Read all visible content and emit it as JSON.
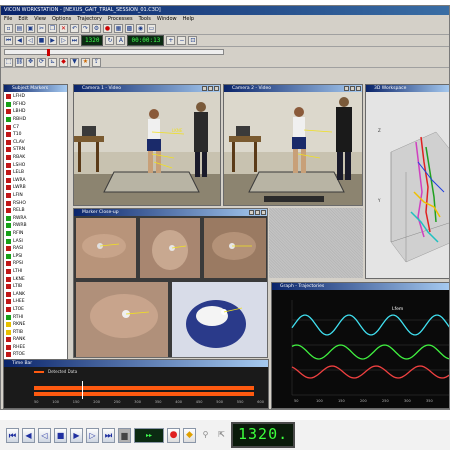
{
  "window": {
    "title": "VICON WORKSTATION - [NEXUS_GAIT_TRIAL_SESSION_01.C3D]",
    "menu": [
      "File",
      "Edit",
      "View",
      "Options",
      "Trajectory",
      "Processes",
      "Tools",
      "Window",
      "Help"
    ]
  },
  "toolbar": {
    "frame_readout": "1320",
    "time_readout": "00:00:13"
  },
  "tree": {
    "items": [
      {
        "label": "LFHD",
        "color": "#c01818"
      },
      {
        "label": "RFHD",
        "color": "#18a018"
      },
      {
        "label": "LBHD",
        "color": "#c01818"
      },
      {
        "label": "RBHD",
        "color": "#18a018"
      },
      {
        "label": "C7",
        "color": "#c01818"
      },
      {
        "label": "T10",
        "color": "#c01818"
      },
      {
        "label": "CLAV",
        "color": "#c01818"
      },
      {
        "label": "STRN",
        "color": "#c01818"
      },
      {
        "label": "RBAK",
        "color": "#c01818"
      },
      {
        "label": "LSHO",
        "color": "#c01818"
      },
      {
        "label": "LELB",
        "color": "#c01818"
      },
      {
        "label": "LWRA",
        "color": "#c01818"
      },
      {
        "label": "LWRB",
        "color": "#c01818"
      },
      {
        "label": "LFIN",
        "color": "#c01818"
      },
      {
        "label": "RSHO",
        "color": "#c01818"
      },
      {
        "label": "RELB",
        "color": "#c01818"
      },
      {
        "label": "RWRA",
        "color": "#18a018"
      },
      {
        "label": "RWRB",
        "color": "#18a018"
      },
      {
        "label": "RFIN",
        "color": "#18a018"
      },
      {
        "label": "LASI",
        "color": "#18a018"
      },
      {
        "label": "RASI",
        "color": "#c01818"
      },
      {
        "label": "LPSI",
        "color": "#18a018"
      },
      {
        "label": "RPSI",
        "color": "#c01818"
      },
      {
        "label": "LTHI",
        "color": "#c01818"
      },
      {
        "label": "LKNE",
        "color": "#c01818"
      },
      {
        "label": "LTIB",
        "color": "#c01818"
      },
      {
        "label": "LANK",
        "color": "#c01818"
      },
      {
        "label": "LHEE",
        "color": "#c01818"
      },
      {
        "label": "LTOE",
        "color": "#c01818"
      },
      {
        "label": "RTHI",
        "color": "#18a018"
      },
      {
        "label": "RKNE",
        "color": "#e8c000"
      },
      {
        "label": "RTIB",
        "color": "#e8c000"
      },
      {
        "label": "RANK",
        "color": "#c01818"
      },
      {
        "label": "RHEE",
        "color": "#c01818"
      },
      {
        "label": "RTOE",
        "color": "#c01818"
      },
      {
        "label": "PELV",
        "color": "#e8c000"
      },
      {
        "label": "Kinetic",
        "color": "#2040c0"
      }
    ]
  },
  "panels": {
    "tree_title": "Subject Markers",
    "cam1_title": "Camera 1 - Video",
    "cam2_title": "Camera 2 - Video",
    "view3d_title": "3D Workspace",
    "zoom_title": "Marker Close-up",
    "graph_title": "Graph - Trajectories",
    "timeline_title": "Time Bar"
  },
  "graph": {
    "legend": "Lfem"
  },
  "timeline": {
    "legend": "Detected Data",
    "ticks": [
      "50",
      "100",
      "150",
      "200",
      "250",
      "300",
      "350",
      "400",
      "450",
      "500",
      "550",
      "600"
    ]
  },
  "bottom": {
    "counter": "1320."
  },
  "colors": {
    "lcd_green": "#3cff3c",
    "wave_cyan": "#40e0f0",
    "wave_green": "#40f040",
    "wave_red": "#f04040",
    "timeline_orange": "#ff5a10"
  }
}
